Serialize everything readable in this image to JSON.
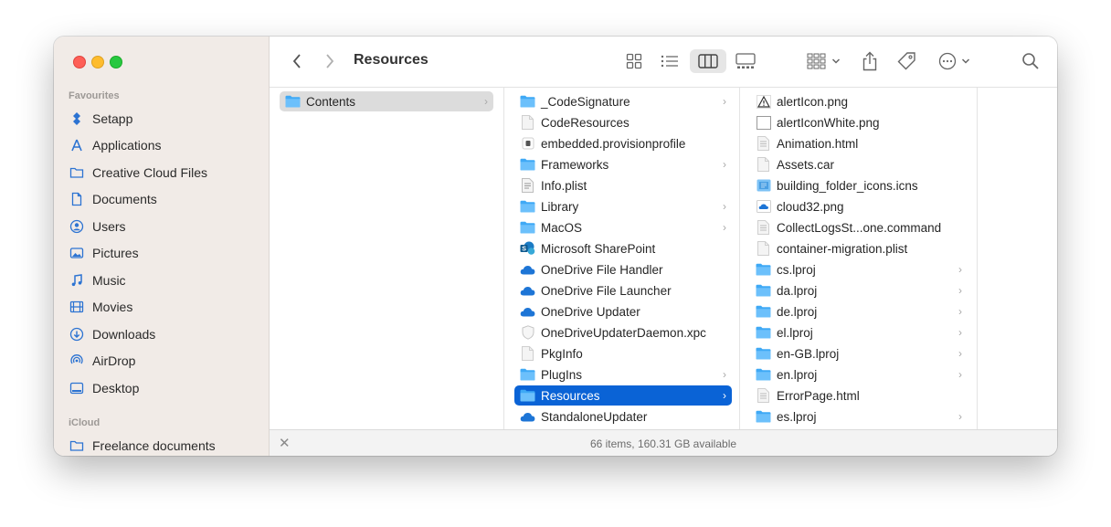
{
  "window": {
    "title": "Resources"
  },
  "sidebar": {
    "favourites_heading": "Favourites",
    "favourites": [
      {
        "label": "Setapp",
        "icon": "setapp-icon"
      },
      {
        "label": "Applications",
        "icon": "applications-icon"
      },
      {
        "label": "Creative Cloud Files",
        "icon": "folder-icon"
      },
      {
        "label": "Documents",
        "icon": "document-icon"
      },
      {
        "label": "Users",
        "icon": "user-icon"
      },
      {
        "label": "Pictures",
        "icon": "pictures-icon"
      },
      {
        "label": "Music",
        "icon": "music-icon"
      },
      {
        "label": "Movies",
        "icon": "movies-icon"
      },
      {
        "label": "Downloads",
        "icon": "downloads-icon"
      },
      {
        "label": "AirDrop",
        "icon": "airdrop-icon"
      },
      {
        "label": "Desktop",
        "icon": "desktop-icon"
      }
    ],
    "icloud_heading": "iCloud",
    "icloud": [
      {
        "label": "Freelance documents",
        "icon": "folder-icon"
      }
    ]
  },
  "columns": [
    {
      "items": [
        {
          "label": "Contents",
          "icon": "folder",
          "has_children": true,
          "selected": "gray"
        }
      ]
    },
    {
      "items": [
        {
          "label": "_CodeSignature",
          "icon": "folder",
          "has_children": true
        },
        {
          "label": "CodeResources",
          "icon": "file"
        },
        {
          "label": "embedded.provisionprofile",
          "icon": "profile"
        },
        {
          "label": "Frameworks",
          "icon": "folder",
          "has_children": true
        },
        {
          "label": "Info.plist",
          "icon": "plist"
        },
        {
          "label": "Library",
          "icon": "folder",
          "has_children": true
        },
        {
          "label": "MacOS",
          "icon": "folder",
          "has_children": true
        },
        {
          "label": "Microsoft SharePoint",
          "icon": "sharepoint"
        },
        {
          "label": "OneDrive File Handler",
          "icon": "cloud"
        },
        {
          "label": "OneDrive File Launcher",
          "icon": "cloud"
        },
        {
          "label": "OneDrive Updater",
          "icon": "cloud"
        },
        {
          "label": "OneDriveUpdaterDaemon.xpc",
          "icon": "xpc"
        },
        {
          "label": "PkgInfo",
          "icon": "file"
        },
        {
          "label": "PlugIns",
          "icon": "folder",
          "has_children": true
        },
        {
          "label": "Resources",
          "icon": "folder",
          "has_children": true,
          "selected": "blue"
        },
        {
          "label": "StandaloneUpdater",
          "icon": "cloud"
        }
      ]
    },
    {
      "items": [
        {
          "label": "alertIcon.png",
          "icon": "warning"
        },
        {
          "label": "alertIconWhite.png",
          "icon": "blank"
        },
        {
          "label": "Animation.html",
          "icon": "doc"
        },
        {
          "label": "Assets.car",
          "icon": "file"
        },
        {
          "label": "building_folder_icons.icns",
          "icon": "icns"
        },
        {
          "label": "cloud32.png",
          "icon": "cloudpng"
        },
        {
          "label": "CollectLogsSt...one.command",
          "icon": "doc"
        },
        {
          "label": "container-migration.plist",
          "icon": "file"
        },
        {
          "label": "cs.lproj",
          "icon": "folder",
          "has_children": true
        },
        {
          "label": "da.lproj",
          "icon": "folder",
          "has_children": true
        },
        {
          "label": "de.lproj",
          "icon": "folder",
          "has_children": true
        },
        {
          "label": "el.lproj",
          "icon": "folder",
          "has_children": true
        },
        {
          "label": "en-GB.lproj",
          "icon": "folder",
          "has_children": true
        },
        {
          "label": "en.lproj",
          "icon": "folder",
          "has_children": true
        },
        {
          "label": "ErrorPage.html",
          "icon": "doc"
        },
        {
          "label": "es.lproj",
          "icon": "folder",
          "has_children": true
        }
      ]
    }
  ],
  "status": {
    "text": "66 items, 160.31 GB available"
  },
  "colors": {
    "accent": "#0a63d6",
    "folder": "#3fa9f5",
    "sidebar_icon": "#2c73d2"
  }
}
